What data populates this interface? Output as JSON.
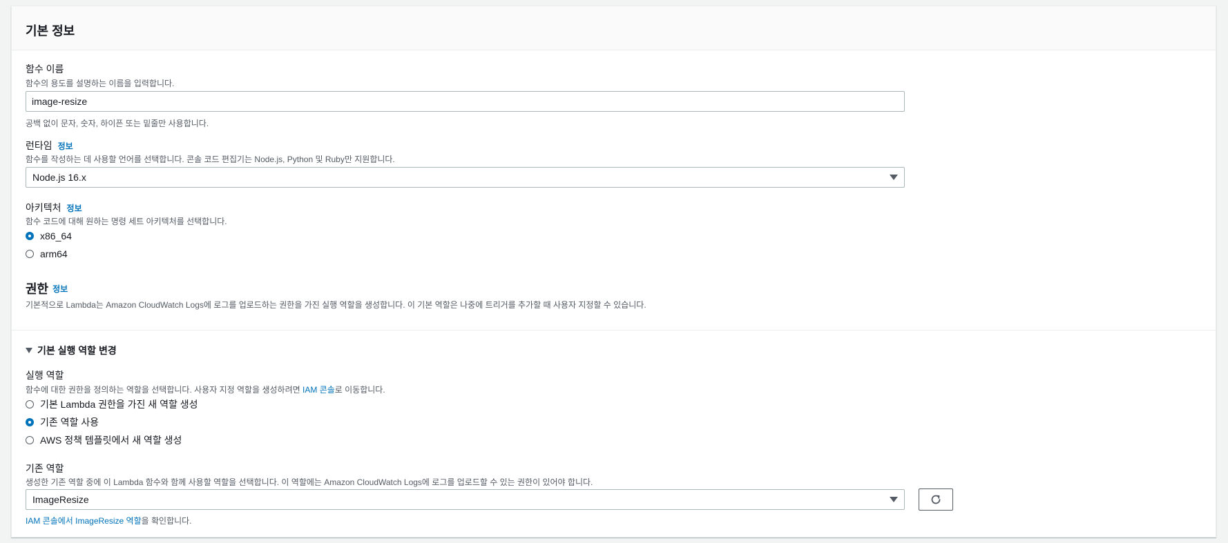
{
  "panel": {
    "title": "기본 정보"
  },
  "function_name": {
    "label": "함수 이름",
    "description": "함수의 용도를 설명하는 이름을 입력합니다.",
    "value": "image-resize",
    "hint": "공백 없이 문자, 숫자, 하이픈 또는 밑줄만 사용합니다."
  },
  "runtime": {
    "label": "런타임",
    "info": "정보",
    "description": "함수를 작성하는 데 사용할 언어를 선택합니다. 콘솔 코드 편집기는 Node.js, Python 및 Ruby만 지원합니다.",
    "selected": "Node.js 16.x"
  },
  "architecture": {
    "label": "아키텍처",
    "info": "정보",
    "description": "함수 코드에 대해 원하는 명령 세트 아키텍처를 선택합니다.",
    "options": [
      {
        "label": "x86_64",
        "checked": true
      },
      {
        "label": "arm64",
        "checked": false
      }
    ]
  },
  "permissions": {
    "title": "권한",
    "info": "정보",
    "description": "기본적으로 Lambda는 Amazon CloudWatch Logs에 로그를 업로드하는 권한을 가진 실행 역할을 생성합니다. 이 기본 역할은 나중에 트리거를 추가할 때 사용자 지정할 수 있습니다."
  },
  "role_change": {
    "label": "기본 실행 역할 변경"
  },
  "execution_role": {
    "label": "실행 역할",
    "description_prefix": "함수에 대한 권한을 정의하는 역할을 선택합니다. 사용자 지정 역할을 생성하려면 ",
    "description_link": "IAM 콘솔",
    "description_suffix": "로 이동합니다.",
    "options": [
      {
        "label": "기본 Lambda 권한을 가진 새 역할 생성",
        "checked": false
      },
      {
        "label": "기존 역할 사용",
        "checked": true
      },
      {
        "label": "AWS 정책 템플릿에서 새 역할 생성",
        "checked": false
      }
    ]
  },
  "existing_role": {
    "label": "기존 역할",
    "description": "생성한 기존 역할 중에 이 Lambda 함수와 함께 사용할 역할을 선택합니다. 이 역할에는 Amazon CloudWatch Logs에 로그를 업로드할 수 있는 권한이 있어야 합니다.",
    "selected": "ImageResize",
    "footer_link": "IAM 콘솔에서 ImageResize 역할",
    "footer_suffix": "을 확인합니다."
  },
  "colors": {
    "link": "#0073bb",
    "text": "#16191f",
    "muted": "#545b64"
  }
}
